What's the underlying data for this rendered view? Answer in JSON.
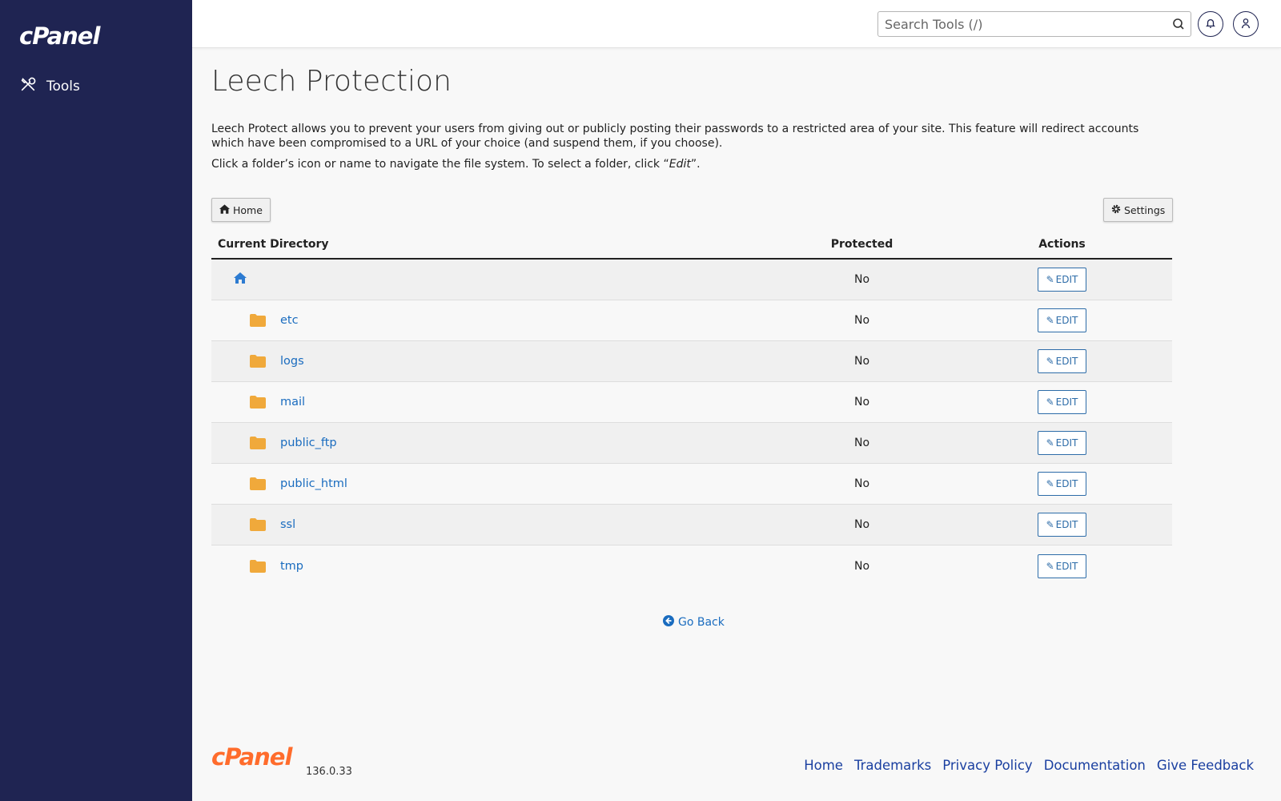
{
  "sidebar": {
    "logo_text": "cPanel",
    "items": [
      {
        "label": "Tools",
        "icon": "tools-icon"
      }
    ]
  },
  "header": {
    "search_placeholder": "Search Tools (/)",
    "icons": [
      "search-icon",
      "bell-icon",
      "user-icon"
    ]
  },
  "page": {
    "title": "Leech Protection",
    "description": "Leech Protect allows you to prevent your users from giving out or publicly posting their passwords to a restricted area of your site. This feature will redirect accounts which have been compromised to a URL of your choice (and suspend them, if you choose).",
    "instruction_prefix": "Click a folder’s icon or name to navigate the file system. To select a folder, click “",
    "instruction_em": "Edit",
    "instruction_suffix": "”.",
    "home_button": "Home",
    "settings_button": "Settings"
  },
  "table": {
    "headers": {
      "directory": "Current Directory",
      "protected": "Protected",
      "actions": "Actions"
    },
    "rows": [
      {
        "name": "",
        "type": "home",
        "protected": "No",
        "action": "EDIT"
      },
      {
        "name": "etc",
        "type": "folder",
        "protected": "No",
        "action": "EDIT"
      },
      {
        "name": "logs",
        "type": "folder",
        "protected": "No",
        "action": "EDIT"
      },
      {
        "name": "mail",
        "type": "folder",
        "protected": "No",
        "action": "EDIT"
      },
      {
        "name": "public_ftp",
        "type": "folder",
        "protected": "No",
        "action": "EDIT"
      },
      {
        "name": "public_html",
        "type": "folder",
        "protected": "No",
        "action": "EDIT"
      },
      {
        "name": "ssl",
        "type": "folder",
        "protected": "No",
        "action": "EDIT"
      },
      {
        "name": "tmp",
        "type": "folder",
        "protected": "No",
        "action": "EDIT"
      }
    ],
    "go_back": "Go Back"
  },
  "footer": {
    "logo_text": "cPanel",
    "version": "136.0.33",
    "links": [
      "Home",
      "Trademarks",
      "Privacy Policy",
      "Documentation",
      "Give Feedback"
    ]
  },
  "colors": {
    "sidebar": "#1f2452",
    "link": "#1a6cbf",
    "folder": "#f0a93b",
    "brand_orange": "#ff6c2c"
  }
}
